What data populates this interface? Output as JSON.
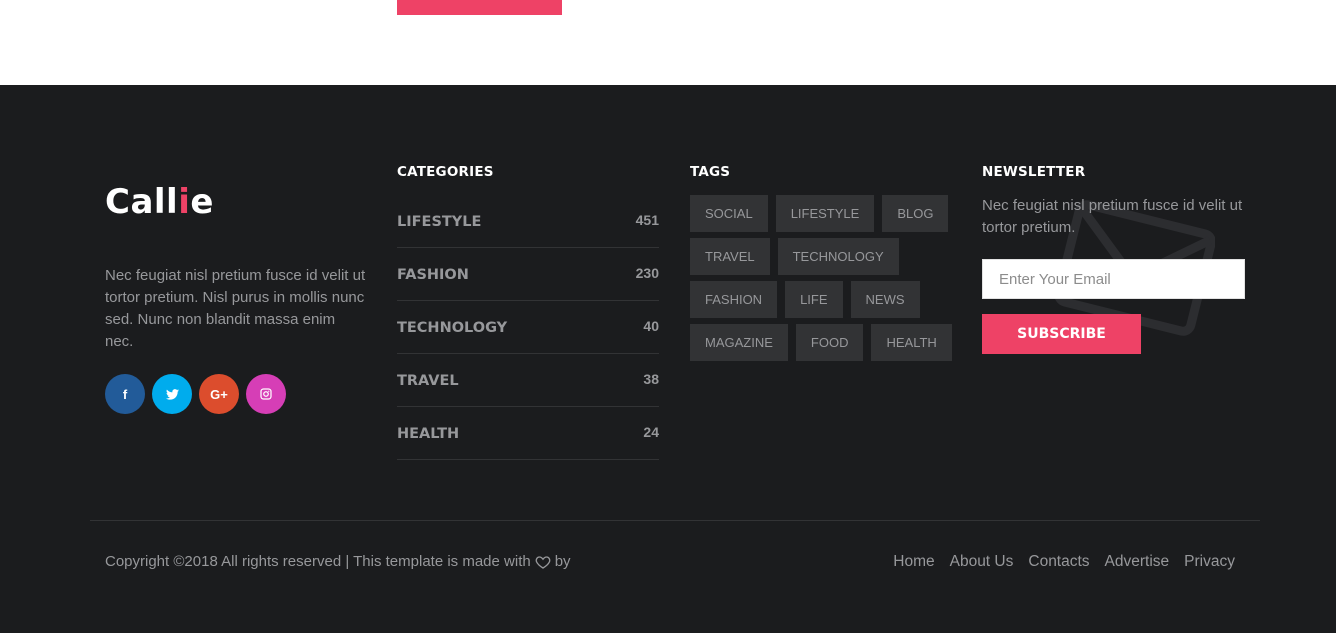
{
  "top_button_label": "",
  "brand": {
    "logo_main": "Call",
    "logo_accent": "i",
    "logo_end": "e",
    "accent_color": "#ee4266"
  },
  "about": {
    "text": "Nec feugiat nisl pretium fusce id velit ut tortor pretium. Nisl purus in mollis nunc sed. Nunc non blandit massa enim nec."
  },
  "socials": [
    {
      "name": "facebook",
      "glyph": "f",
      "color": "#225b99"
    },
    {
      "name": "twitter",
      "glyph": "🐦",
      "color": "#00aced"
    },
    {
      "name": "google-plus",
      "glyph": "G+",
      "color": "#dc4d2d"
    },
    {
      "name": "instagram",
      "glyph": "◎",
      "color": "#d63eb6"
    }
  ],
  "categories": {
    "title": "CATEGORIES",
    "items": [
      {
        "name": "LIFESTYLE",
        "count": "451"
      },
      {
        "name": "FASHION",
        "count": "230"
      },
      {
        "name": "TECHNOLOGY",
        "count": "40"
      },
      {
        "name": "TRAVEL",
        "count": "38"
      },
      {
        "name": "HEALTH",
        "count": "24"
      }
    ]
  },
  "tags": {
    "title": "TAGS",
    "items": [
      "SOCIAL",
      "LIFESTYLE",
      "BLOG",
      "TRAVEL",
      "TECHNOLOGY",
      "FASHION",
      "LIFE",
      "NEWS",
      "MAGAZINE",
      "FOOD",
      "HEALTH"
    ]
  },
  "newsletter": {
    "title": "NEWSLETTER",
    "text": "Nec feugiat nisl pretium fusce id velit ut tortor pretium.",
    "email_placeholder": "Enter Your Email",
    "email_value": "",
    "button_label": "SUBSCRIBE"
  },
  "bottom": {
    "copyright_before": "Copyright ©2018 All rights reserved | This template is made with",
    "copyright_after": "by",
    "nav": [
      "Home",
      "About Us",
      "Contacts",
      "Advertise",
      "Privacy"
    ]
  }
}
